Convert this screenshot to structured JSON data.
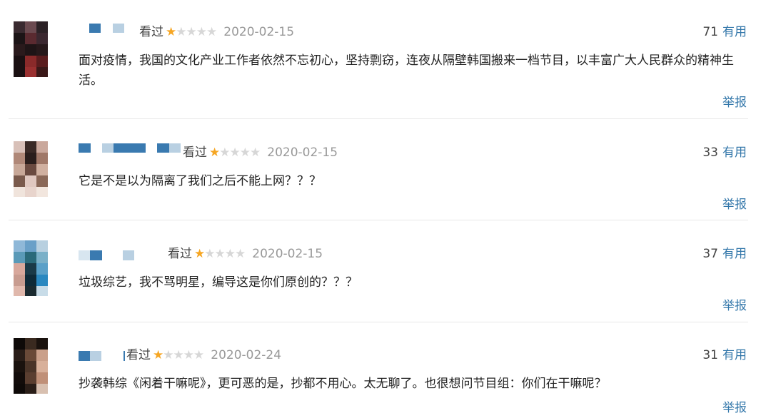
{
  "reviews": [
    {
      "status": "看过",
      "rating": 1,
      "date": "2020-02-15",
      "votes": "71",
      "useful_label": "有用",
      "content": "面对疫情，我国的文化产业工作者依然不忘初心，坚持剽窃，连夜从隔壁韩国搬来一档节目，以丰富广大人民群众的精神生活。",
      "report_label": "举报"
    },
    {
      "status": "看过",
      "rating": 1,
      "date": "2020-02-15",
      "votes": "33",
      "useful_label": "有用",
      "content": "它是不是以为隔离了我们之后不能上网？？？",
      "report_label": "举报"
    },
    {
      "status": "看过",
      "rating": 1,
      "date": "2020-02-15",
      "votes": "37",
      "useful_label": "有用",
      "content": "垃圾综艺，我不骂明星，编导这是你们原创的？？？",
      "report_label": "举报"
    },
    {
      "status": "看过",
      "rating": 1,
      "date": "2020-02-24",
      "votes": "31",
      "useful_label": "有用",
      "content": "抄袭韩综《闲着干嘛呢》，更可恶的是，抄都不用心。太无聊了。也很想问节目组：你们在干嘛呢？",
      "report_label": "举报"
    }
  ],
  "colors": {
    "link": "#3377aa",
    "star_on": "#f6a623",
    "star_off": "#d7d7d7",
    "date": "#999999"
  }
}
